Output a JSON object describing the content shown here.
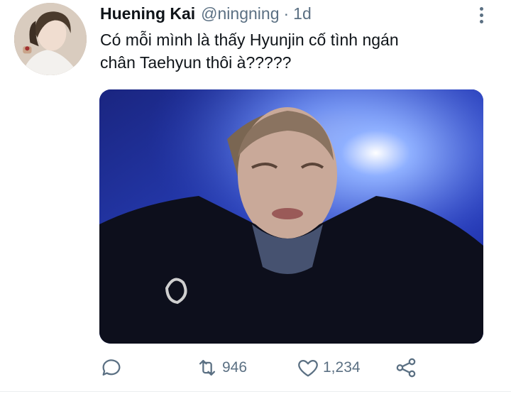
{
  "tweet": {
    "author": {
      "display_name": "Huening Kai",
      "handle": "@ningning",
      "separator": "·",
      "time": "1d",
      "avatar_icon": "avatar-photo"
    },
    "text_lines": [
      "Có mỗi mình là thấy Hyunjin cố tình ngán",
      "chân Taehyun thôi à?????"
    ],
    "media": {
      "description_icon": "photo-media"
    },
    "actions": {
      "reply_icon": "reply-icon",
      "retweet_icon": "retweet-icon",
      "retweet_count": "946",
      "like_icon": "heart-icon",
      "like_count": "1,234",
      "share_icon": "share-icon"
    },
    "more_icon": "more-vertical-icon"
  },
  "colors": {
    "text_primary": "#0f1419",
    "text_secondary": "#5b7083",
    "media_bg": "#1b2a8a"
  }
}
